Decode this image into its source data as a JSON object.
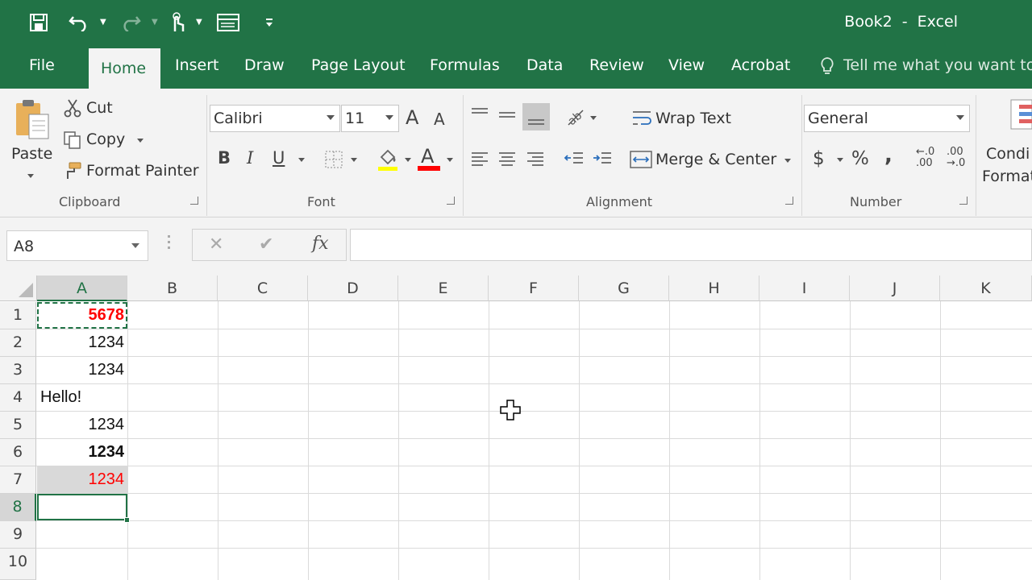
{
  "title": {
    "doc": "Book2  -  Excel"
  },
  "tabs": [
    {
      "label": "File"
    },
    {
      "label": "Home"
    },
    {
      "label": "Insert"
    },
    {
      "label": "Draw"
    },
    {
      "label": "Page Layout"
    },
    {
      "label": "Formulas"
    },
    {
      "label": "Data"
    },
    {
      "label": "Review"
    },
    {
      "label": "View"
    },
    {
      "label": "Acrobat"
    }
  ],
  "tellme": "Tell me what you want to",
  "clipboard": {
    "paste": "Paste",
    "cut": "Cut",
    "copy": "Copy",
    "format_painter": "Format Painter",
    "group": "Clipboard"
  },
  "font": {
    "name": "Calibri",
    "size": "11",
    "bold": "B",
    "italic": "I",
    "underline": "U",
    "group": "Font",
    "grow": "A",
    "shrink": "A",
    "color_letter": "A"
  },
  "alignment": {
    "wrap_text": "Wrap Text",
    "merge_center": "Merge & Center",
    "group": "Alignment"
  },
  "number": {
    "format": "General",
    "currency": "$",
    "percent": "%",
    "comma": ",",
    "inc": "←.0\n.00",
    "dec": ".00\n→.0",
    "group": "Number"
  },
  "styles": {
    "cond_line1": "Condi",
    "cond_line2": "Format"
  },
  "formula_bar": {
    "name_box": "A8",
    "fx": "fx",
    "cancel": "✕",
    "enter": "✔",
    "content": ""
  },
  "columns": [
    "A",
    "B",
    "C",
    "D",
    "E",
    "F",
    "G",
    "H",
    "I",
    "J",
    "K"
  ],
  "rows": [
    "1",
    "2",
    "3",
    "4",
    "5",
    "6",
    "7",
    "8",
    "9",
    "10"
  ],
  "cells": {
    "A1": "5678",
    "A2": "1234",
    "A3": "1234",
    "A4": "Hello!",
    "A5": "1234",
    "A6": "1234",
    "A7": "1234",
    "A8": ""
  },
  "colors": {
    "excel_green": "#217346",
    "red_text": "#ff0000",
    "selection": "#217346"
  }
}
